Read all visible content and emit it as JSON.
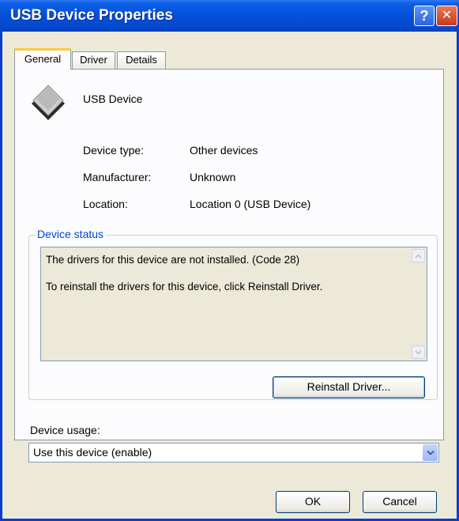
{
  "window": {
    "title": "USB Device Properties"
  },
  "titlebar": {
    "help_glyph": "?",
    "close_glyph": "✕"
  },
  "tabs": [
    {
      "label": "General"
    },
    {
      "label": "Driver"
    },
    {
      "label": "Details"
    }
  ],
  "device": {
    "icon": "usb-device-icon",
    "name": "USB Device",
    "properties": [
      {
        "label": "Device type:",
        "value": "Other devices"
      },
      {
        "label": "Manufacturer:",
        "value": "Unknown"
      },
      {
        "label": "Location:",
        "value": "Location 0 (USB Device)"
      }
    ]
  },
  "status": {
    "group_title": "Device status",
    "line1": "The drivers for this device are not installed. (Code 28)",
    "line2": "To reinstall the drivers for this device, click Reinstall Driver.",
    "reinstall_button": "Reinstall Driver..."
  },
  "usage": {
    "label": "Device usage:",
    "selected": "Use this device (enable)"
  },
  "buttons": {
    "ok": "OK",
    "cancel": "Cancel"
  },
  "colors": {
    "title_bar": "#0650d8",
    "dialog_face": "#ece9d8",
    "group_title": "#0046d5",
    "close_button": "#c8391b"
  }
}
